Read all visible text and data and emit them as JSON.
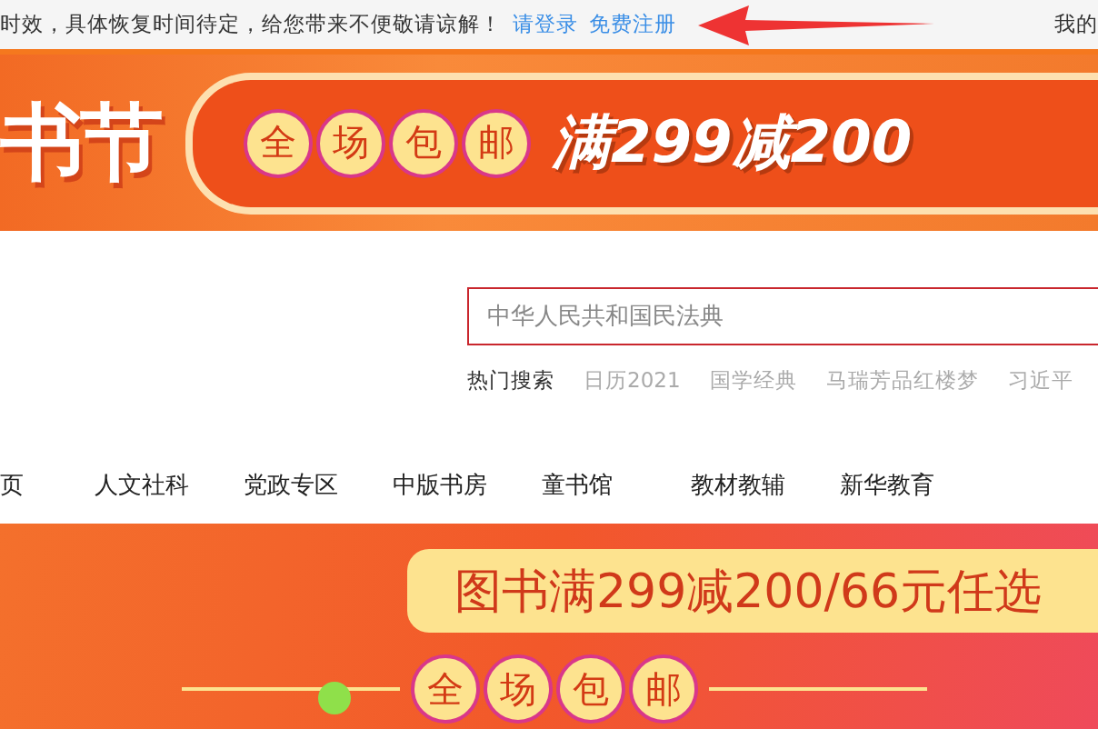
{
  "top_bar": {
    "notice": "时效，具体恢复时间待定，给您带来不便敬请谅解！",
    "links": [
      "请登录",
      "免费注册"
    ],
    "account": "我的"
  },
  "top_banner": {
    "title": "书节",
    "badges": [
      "全",
      "场",
      "包",
      "邮"
    ],
    "promo": "满299减200"
  },
  "search": {
    "placeholder": "中华人民共和国民法典",
    "hot_label": "热门搜索",
    "hot_terms": [
      "日历2021",
      "国学经典",
      "马瑞芳品红楼梦",
      "习近平"
    ]
  },
  "nav": {
    "items": [
      "页",
      "人文社科",
      "党政专区",
      "中版书房",
      "童书馆",
      "教材教辅",
      "新华教育"
    ]
  },
  "promo_banner": {
    "headline": "图书满299减200/66元任选",
    "badges": [
      "全",
      "场",
      "包",
      "邮"
    ]
  }
}
